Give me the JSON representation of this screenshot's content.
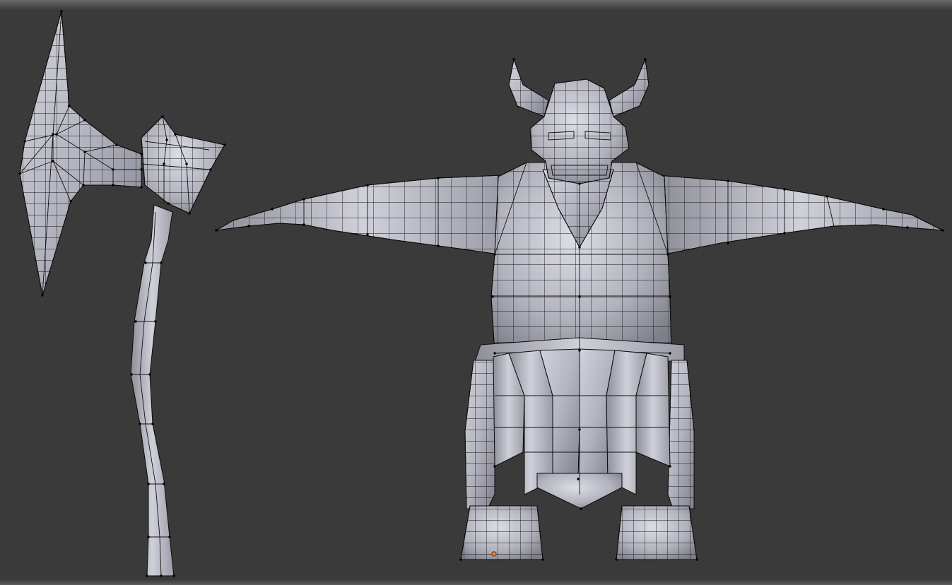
{
  "viewport": {
    "background_color": "#3a3a3a",
    "mode": "edit-mode-wireframe-over-solid"
  },
  "objects": [
    {
      "name": "axe",
      "icon": "mesh-icon"
    },
    {
      "name": "ogre",
      "icon": "mesh-icon"
    }
  ],
  "colors": {
    "mesh_light": "#c7c8d2",
    "mesh_mid": "#9a9ba6",
    "mesh_dark": "#6f707a",
    "wire": "#111111",
    "vertex": "#000000",
    "cursor_3d": "#e08a2c"
  }
}
